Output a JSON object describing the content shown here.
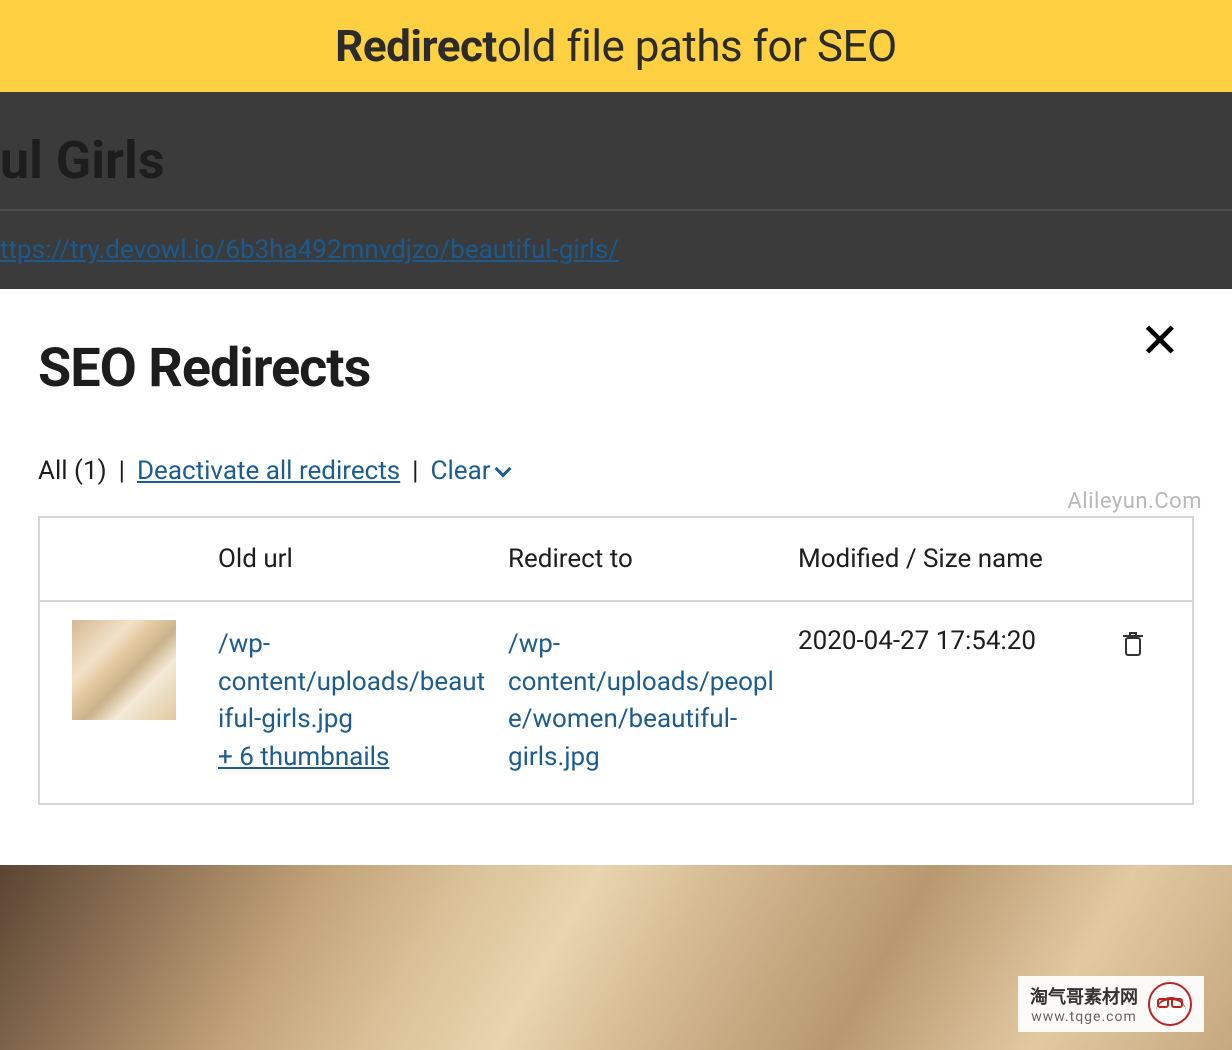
{
  "banner": {
    "bold": "Redirect",
    "rest": " old file paths for SEO"
  },
  "background": {
    "page_title_partial": "ul Girls",
    "permalink_partial": "ttps://try.devowl.io/6b3ha492mnvdjzo/beautiful-girls/"
  },
  "modal": {
    "title": "SEO Redirects",
    "controls": {
      "all_label": "All (1)",
      "deactivate_label": "Deactivate all redirects",
      "clear_label": "Clear"
    },
    "table": {
      "headers": {
        "old": "Old url",
        "redirect": "Redirect to",
        "modified": "Modified / Size name"
      },
      "rows": [
        {
          "old_url": "/wp-content/uploads/beautiful-girls.jpg",
          "old_extra": "+ 6 thumbnails",
          "redirect_to": "/wp-content/uploads/people/women/beautiful-girls.jpg",
          "modified": "2020-04-27 17:54:20"
        }
      ]
    }
  },
  "watermarks": {
    "side": "Alileyun.Com",
    "box_cn": "淘气哥素材网",
    "box_url": "www.tqge.com"
  }
}
